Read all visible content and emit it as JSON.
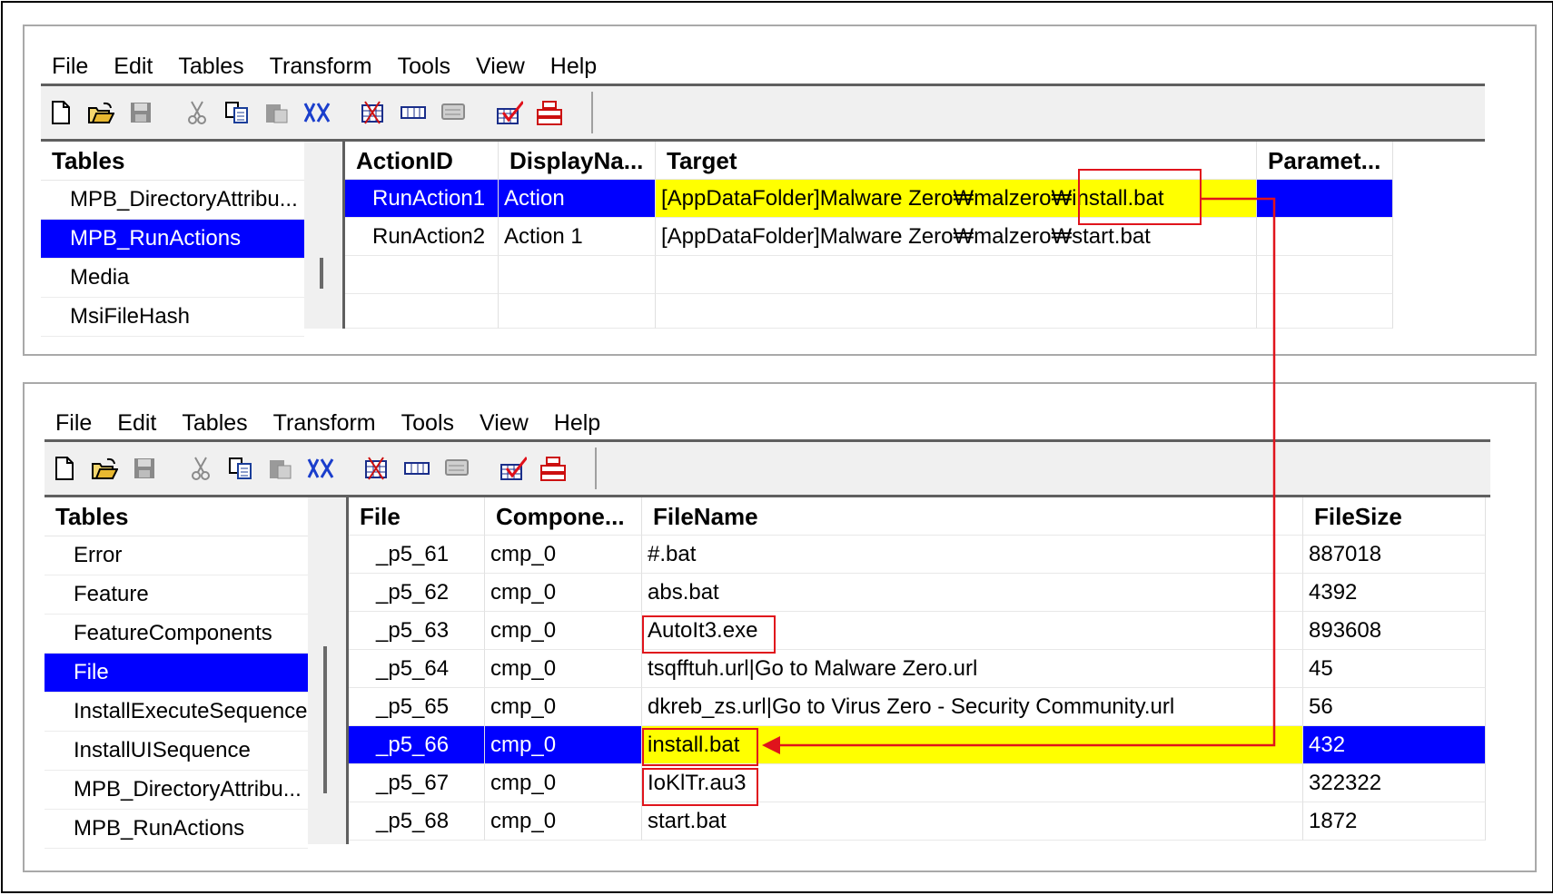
{
  "menu": [
    "File",
    "Edit",
    "Tables",
    "Transform",
    "Tools",
    "View",
    "Help"
  ],
  "toolbar_icons": [
    "new-icon",
    "open-icon",
    "save-icon",
    "cut-icon",
    "copy-icon",
    "paste-icon",
    "replace-icon",
    "table-add-icon",
    "row-add-icon",
    "row-delete-icon",
    "validate-icon",
    "schema-icon"
  ],
  "top": {
    "tables_header": "Tables",
    "tables": [
      "MPB_DirectoryAttribu...",
      "MPB_RunActions",
      "Media",
      "MsiFileHash"
    ],
    "selected_table": "MPB_RunActions",
    "columns": [
      "ActionID",
      "DisplayNa...",
      "Target",
      "Paramet..."
    ],
    "rows": [
      [
        "RunAction1",
        "Action",
        "[AppDataFolder]Malware Zero₩malzero₩install.bat",
        ""
      ],
      [
        "RunAction2",
        "Action 1",
        "[AppDataFolder]Malware Zero₩malzero₩start.bat",
        ""
      ]
    ]
  },
  "bottom": {
    "tables_header": "Tables",
    "tables": [
      "Error",
      "Feature",
      "FeatureComponents",
      "File",
      "InstallExecuteSequence",
      "InstallUISequence",
      "MPB_DirectoryAttribu...",
      "MPB_RunActions"
    ],
    "selected_table": "File",
    "columns": [
      "File",
      "Compone...",
      "FileName",
      "FileSize"
    ],
    "rows": [
      [
        "_p5_61",
        "cmp_0",
        "#.bat",
        "887018"
      ],
      [
        "_p5_62",
        "cmp_0",
        "abs.bat",
        "4392"
      ],
      [
        "_p5_63",
        "cmp_0",
        "AutoIt3.exe",
        "893608"
      ],
      [
        "_p5_64",
        "cmp_0",
        "tsqfftuh.url|Go to Malware Zero.url",
        "45"
      ],
      [
        "_p5_65",
        "cmp_0",
        "dkreb_zs.url|Go to Virus Zero - Security Community.url",
        "56"
      ],
      [
        "_p5_66",
        "cmp_0",
        "install.bat",
        "432"
      ],
      [
        "_p5_67",
        "cmp_0",
        "IoKlTr.au3",
        "322322"
      ],
      [
        "_p5_68",
        "cmp_0",
        "start.bat",
        "1872"
      ]
    ]
  },
  "colors": {
    "selection": "#0000ff",
    "highlight": "#ffff00",
    "annotation": "#e0141c"
  }
}
